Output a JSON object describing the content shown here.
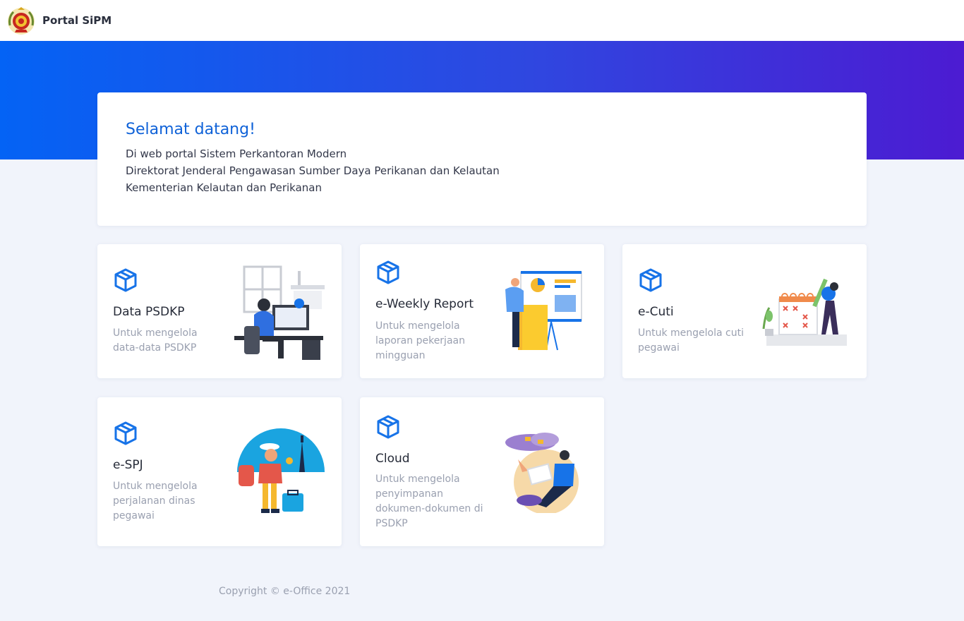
{
  "header": {
    "brand": "Portal SiPM",
    "logo_icon": "emblem-icon"
  },
  "welcome": {
    "title": "Selamat datang!",
    "lines": [
      "Di web portal Sistem Perkantoran Modern",
      "Direktorat Jenderal Pengawasan Sumber Daya Perikanan dan Kelautan",
      "Kementerian Kelautan dan Perikanan"
    ]
  },
  "cards": [
    {
      "title": "Data PSDKP",
      "desc": "Untuk mengelola data-data PSDKP",
      "icon": "cube-icon"
    },
    {
      "title": "e-Weekly Report",
      "desc": "Untuk mengelola laporan pekerjaan mingguan",
      "icon": "cube-icon"
    },
    {
      "title": "e-Cuti",
      "desc": "Untuk mengelola cuti pegawai",
      "icon": "cube-icon"
    },
    {
      "title": "e-SPJ",
      "desc": "Untuk mengelola perjalanan dinas pegawai",
      "icon": "cube-icon"
    },
    {
      "title": "Cloud",
      "desc": "Untuk mengelola penyimpanan dokumen-dokumen di PSDKP",
      "icon": "cube-icon"
    }
  ],
  "footer": {
    "copyright": "Copyright © e-Office 2021"
  },
  "colors": {
    "accent": "#0f62d8",
    "hero_start": "#0463f5",
    "hero_end": "#4c1bd2",
    "background": "#f1f4fb"
  }
}
